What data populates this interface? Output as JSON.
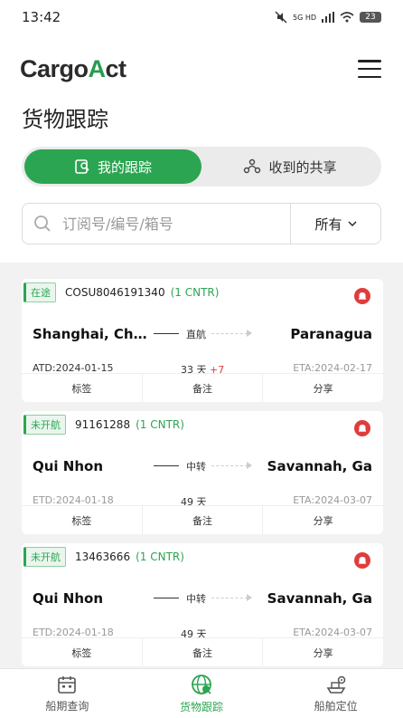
{
  "status_bar": {
    "time": "13:42",
    "network": "5G HD",
    "battery": "23"
  },
  "header": {
    "logo_left": "Cargo",
    "logo_accent": "A",
    "logo_right": "ct"
  },
  "page_title": "货物跟踪",
  "segments": [
    {
      "label": "我的跟踪",
      "active": true
    },
    {
      "label": "收到的共享",
      "active": false
    }
  ],
  "search": {
    "placeholder": "订阅号/编号/箱号",
    "filter_label": "所有"
  },
  "cards": [
    {
      "status": "在途",
      "number": "COSU8046191340",
      "containers": "(1 CNTR)",
      "from": "Shanghai, Ch…",
      "to": "Paranagua",
      "route_type": "直航",
      "departure": "ATD:2024-01-15",
      "duration": "33 天",
      "delay": "+7",
      "arrival": "ETA:2024-02-17",
      "actions": [
        "标签",
        "备注",
        "分享"
      ]
    },
    {
      "status": "未开航",
      "number": "91161288",
      "containers": "(1 CNTR)",
      "from": "Qui Nhon",
      "to": "Savannah, Ga",
      "route_type": "中转",
      "departure": "ETD:2024-01-18",
      "duration": "49 天",
      "delay": "",
      "arrival": "ETA:2024-03-07",
      "actions": [
        "标签",
        "备注",
        "分享"
      ]
    },
    {
      "status": "未开航",
      "number": "13463666",
      "containers": "(1 CNTR)",
      "from": "Qui Nhon",
      "to": "Savannah, Ga",
      "route_type": "中转",
      "departure": "ETD:2024-01-18",
      "duration": "49 天",
      "delay": "",
      "arrival": "ETA:2024-03-07",
      "actions": [
        "标签",
        "备注",
        "分享"
      ]
    }
  ],
  "bottom_nav": [
    {
      "label": "船期查询",
      "icon": "calendar-icon",
      "active": false
    },
    {
      "label": "货物跟踪",
      "icon": "globe-icon",
      "active": true
    },
    {
      "label": "船舶定位",
      "icon": "ship-location-icon",
      "active": false
    }
  ],
  "colors": {
    "accent": "#2ca552",
    "alert": "#e03c3c"
  }
}
